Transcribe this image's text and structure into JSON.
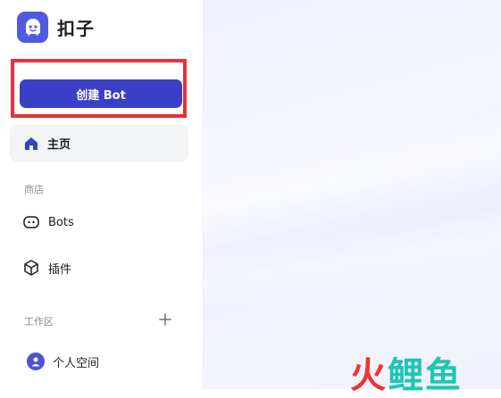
{
  "app": {
    "name": "扣子"
  },
  "sidebar": {
    "create_button": "创建 Bot",
    "home": {
      "label": "主页",
      "icon": "home-icon"
    },
    "store_section": "商店",
    "store_items": [
      {
        "label": "Bots",
        "icon": "bot-face-icon"
      },
      {
        "label": "插件",
        "icon": "cube-icon"
      }
    ],
    "workspace_section": "工作区",
    "workspace_items": [
      {
        "label": "个人空间",
        "icon": "user-avatar-icon"
      }
    ]
  },
  "watermark": {
    "part1": "火",
    "part2": "鲤",
    "part3": "鱼"
  },
  "colors": {
    "accent": "#3a3fc7",
    "logo": "#4f5bdf",
    "highlight_border": "#e8313a",
    "watermark_red": "#f1322f",
    "watermark_teal": "#1ec6b2"
  }
}
